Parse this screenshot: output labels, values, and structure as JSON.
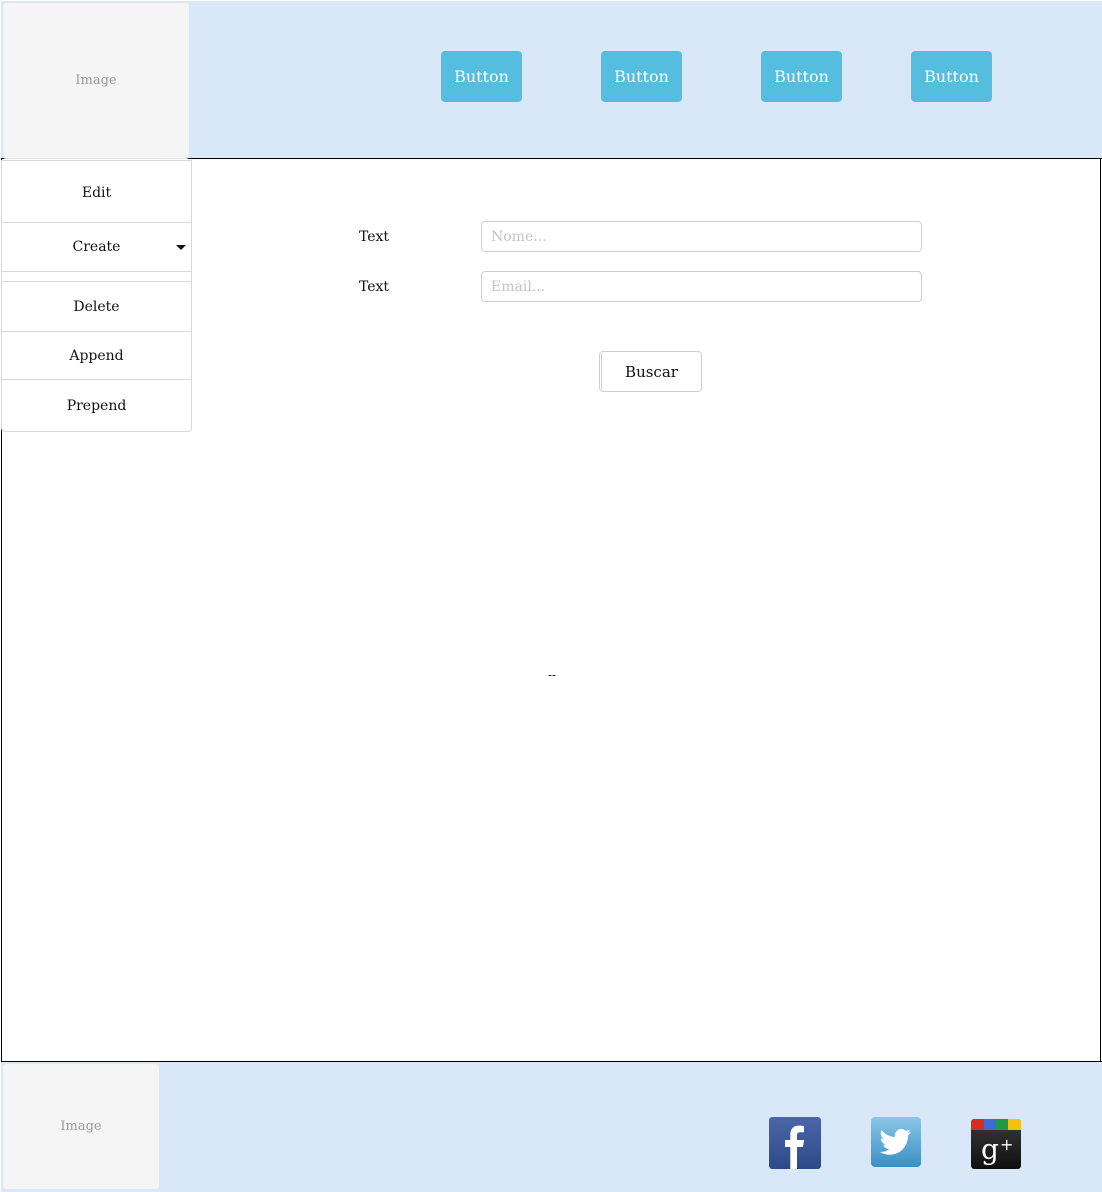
{
  "header": {
    "logo_label": "Image",
    "nav_buttons": [
      "Button",
      "Button",
      "Button",
      "Button"
    ],
    "accent_color": "#55bddd",
    "background_color": "#d9e8f9"
  },
  "menu": {
    "items": [
      {
        "label": "Edit",
        "icon": null
      },
      {
        "label": "Create",
        "icon": "caret-down-icon"
      },
      {
        "label": "Delete",
        "icon": null
      },
      {
        "label": "Append",
        "icon": null
      },
      {
        "label": "Prepend",
        "icon": null
      }
    ]
  },
  "form": {
    "name_label": "Text",
    "name_placeholder": "Nome...",
    "email_label": "Text",
    "email_placeholder": "Email...",
    "search_button": "Buscar"
  },
  "content": {
    "result_text": "--"
  },
  "footer": {
    "logo_label": "Image",
    "social_icons": [
      "facebook-icon",
      "twitter-icon",
      "google-plus-icon"
    ]
  }
}
